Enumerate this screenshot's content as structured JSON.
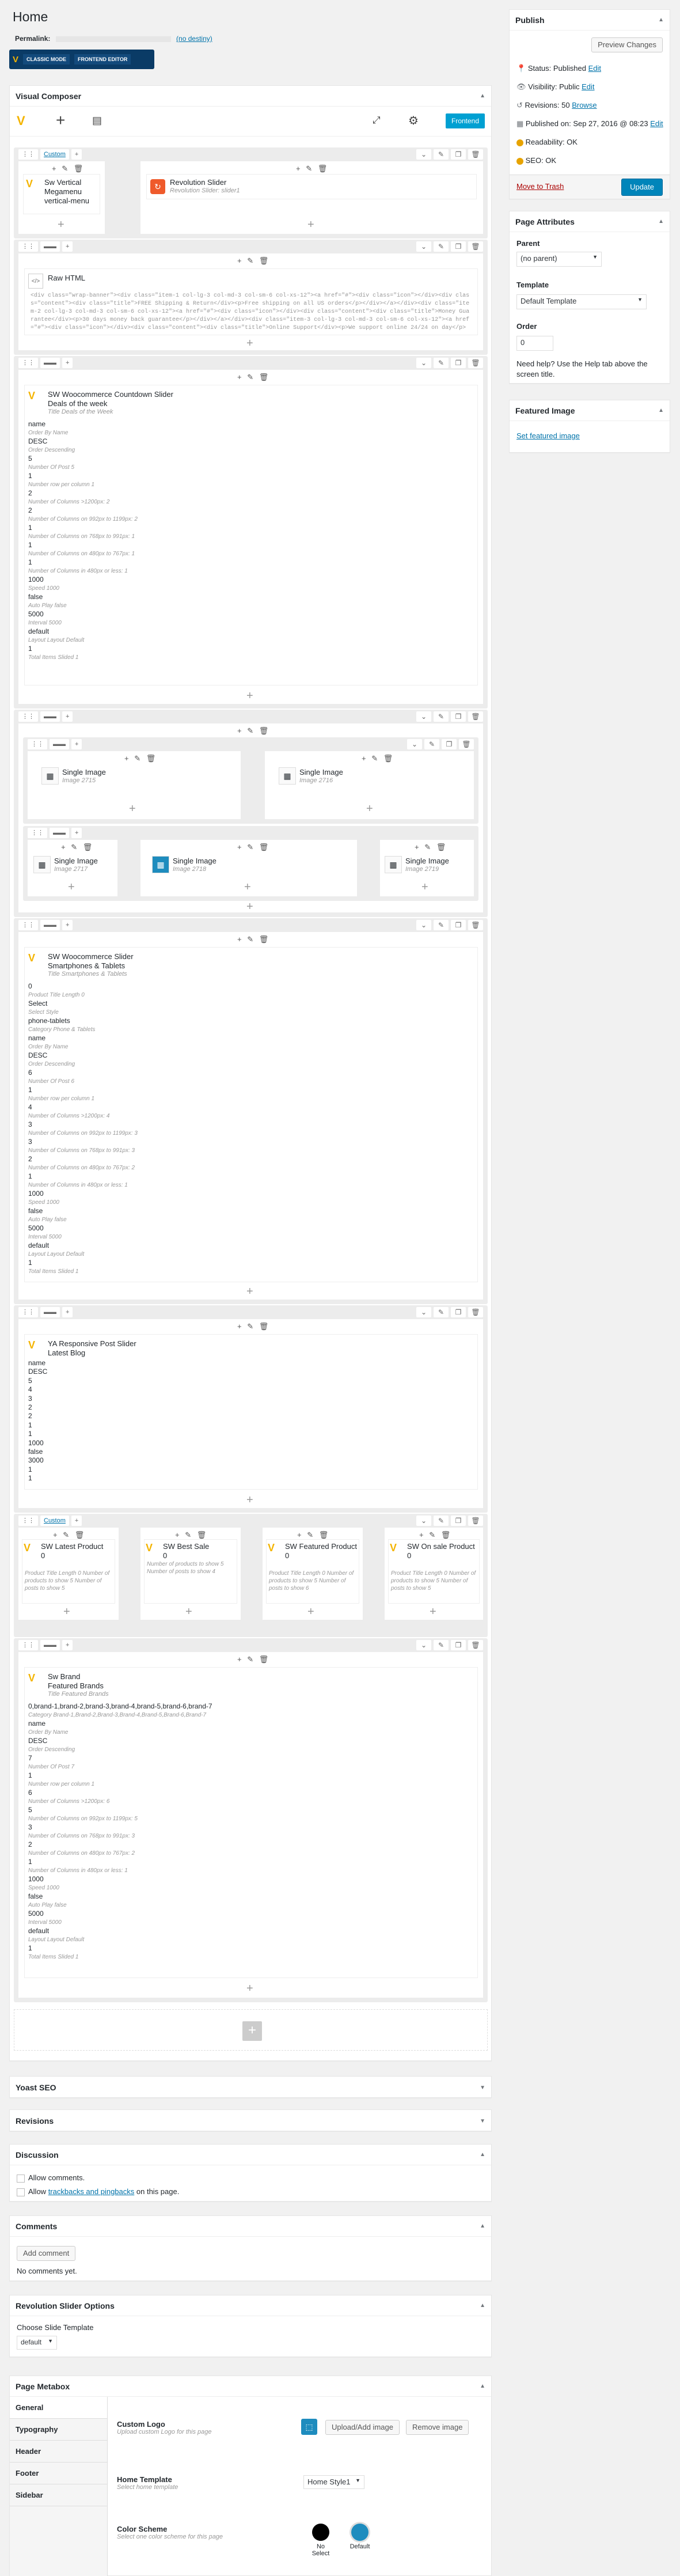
{
  "page": {
    "heading": "Home",
    "permalink_label": "Permalink:",
    "permalink_action": "(no destiny)",
    "classic_mode": "CLASSIC MODE",
    "frontend_editor": "FRONTEND EDITOR"
  },
  "vc": {
    "title": "Visual Composer",
    "frontend_btn": "Frontend",
    "custom_label": "Custom"
  },
  "rows": {
    "r1": {
      "el1_title": "Sw Vertical Megamenu",
      "el1_sub": "vertical-menu",
      "el2_title": "Revolution Slider",
      "el2_sub": "Revolution Slider: slider1"
    },
    "r2": {
      "title": "Raw HTML",
      "code": "<div class=\"wrap-banner\"><div class=\"item-1 col-lg-3 col-md-3 col-sm-6 col-xs-12\"><a href=\"#\"><div class=\"icon\"></div><div class=\"content\"><div class=\"title\">FREE Shipping & Return</div><p>Free shipping on all US orders</p></div></a></div><div class=\"item-2 col-lg-3 col-md-3 col-sm-6 col-xs-12\"><a href=\"#\"><div class=\"icon\"></div><div class=\"content\"><div class=\"title\">Money Guarantee</div><p>30 days money back guarantee</p></div></a></div><div class=\"item-3 col-lg-3 col-md-3 col-sm-6 col-xs-12\"><a href=\"#\"><div class=\"icon\"></div><div class=\"content\"><div class=\"title\">Online Support</div><p>We support online 24/24 on day</p></div></a></div></div>"
    },
    "r3": {
      "title": "SW Woocommerce Countdown Slider",
      "sub": "Deals of the week",
      "sub2": "Title Deals of the Week",
      "items": [
        [
          "name",
          "Order By Name"
        ],
        [
          "DESC",
          "Order Descending"
        ],
        [
          "5",
          "Number Of Post 5"
        ],
        [
          "1",
          "Number row per column 1"
        ],
        [
          "2",
          "Number of Columns >1200px: 2"
        ],
        [
          "2",
          "Number of Columns on 992px to 1199px: 2"
        ],
        [
          "1",
          "Number of Columns on 768px to 991px: 1"
        ],
        [
          "1",
          "Number of Columns on 480px to 767px: 1"
        ],
        [
          "1",
          "Number of Columns in 480px or less: 1"
        ],
        [
          "1000",
          "Speed 1000"
        ],
        [
          "false",
          "Auto Play false"
        ],
        [
          "5000",
          "Interval 5000"
        ],
        [
          "default",
          "Layout Layout Default"
        ],
        [
          "1",
          "Total Items Slided 1"
        ]
      ]
    },
    "r4": {
      "s1": "Single Image",
      "s1sub": "Image 2715",
      "s2": "Single Image",
      "s2sub": "Image 2716",
      "s3": "Single Image",
      "s3sub": "Image 2717",
      "s4": "Single Image",
      "s4sub": "Image 2718",
      "s5": "Single Image",
      "s5sub": "Image 2719"
    },
    "r5": {
      "title": "SW Woocommerce Slider",
      "sub": "Smartphones & Tablets",
      "sub2": "Title Smartphones & Tablets",
      "items": [
        [
          "0",
          "Product Title Length 0"
        ],
        [
          "Select",
          "Select Style"
        ],
        [
          "phone-tablets",
          "Category Phone & Tablets"
        ],
        [
          "name",
          "Order By Name"
        ],
        [
          "DESC",
          "Order Descending"
        ],
        [
          "6",
          "Number Of Post 6"
        ],
        [
          "1",
          "Number row per column 1"
        ],
        [
          "4",
          "Number of Columns >1200px: 4"
        ],
        [
          "3",
          "Number of Columns on 992px to 1199px: 3"
        ],
        [
          "3",
          "Number of Columns on 768px to 991px: 3"
        ],
        [
          "2",
          "Number of Columns on 480px to 767px: 2"
        ],
        [
          "1",
          "Number of Columns in 480px or less: 1"
        ],
        [
          "1000",
          "Speed 1000"
        ],
        [
          "false",
          "Auto Play false"
        ],
        [
          "5000",
          "Interval 5000"
        ],
        [
          "default",
          "Layout Layout Default"
        ],
        [
          "1",
          "Total Items Slided 1"
        ]
      ]
    },
    "r6": {
      "title": "YA Responsive Post Slider",
      "sub": "Latest Blog",
      "items": [
        "name",
        "DESC",
        "5",
        "4",
        "3",
        "2",
        "2",
        "1",
        "1",
        "1000",
        "false",
        "3000",
        "1",
        "1"
      ]
    },
    "r7": {
      "c1_title": "SW Latest Product",
      "c1_v": "0",
      "c1_desc": "Product Title Length 0 Number of products to show 5 Number of posts to show 5",
      "c2_title": "SW Best Sale",
      "c2_v": "0",
      "c2_desc": "Number of products to show 5 Number of posts to show 4",
      "c3_title": "SW Featured Product",
      "c3_v": "0",
      "c3_desc": "Product Title Length 0 Number of products to show 5 Number of posts to show 6",
      "c4_title": "SW On sale Product",
      "c4_v": "0",
      "c4_desc": "Product Title Length 0 Number of products to show 5 Number of posts to show 5"
    },
    "r8": {
      "title": "Sw Brand",
      "sub": "Featured Brands",
      "sub2": "Title Featured Brands",
      "brands": "0,brand-1,brand-2,brand-3,brand-4,brand-5,brand-6,brand-7",
      "brands_k": "Category Brand-1,Brand-2,Brand-3,Brand-4,Brand-5,Brand-6,Brand-7",
      "items": [
        [
          "name",
          "Order By Name"
        ],
        [
          "DESC",
          "Order Descending"
        ],
        [
          "7",
          "Number Of Post 7"
        ],
        [
          "1",
          "Number row per column 1"
        ],
        [
          "6",
          "Number of Columns >1200px: 6"
        ],
        [
          "5",
          "Number of Columns on 992px to 1199px: 5"
        ],
        [
          "3",
          "Number of Columns on 768px to 991px: 3"
        ],
        [
          "2",
          "Number of Columns on 480px to 767px: 2"
        ],
        [
          "1",
          "Number of Columns in 480px or less: 1"
        ],
        [
          "1000",
          "Speed 1000"
        ],
        [
          "false",
          "Auto Play false"
        ],
        [
          "5000",
          "Interval 5000"
        ],
        [
          "default",
          "Layout Layout Default"
        ],
        [
          "1",
          "Total Items Slided 1"
        ]
      ]
    }
  },
  "boxes": {
    "yoast": "Yoast SEO",
    "revisions": "Revisions",
    "discussion": "Discussion",
    "allow_comments": "Allow comments.",
    "allow_tb_pre": "Allow ",
    "allow_tb_link": "trackbacks and pingbacks",
    "allow_tb_post": " on this page.",
    "comments": "Comments",
    "add_comment": "Add comment",
    "no_comments": "No comments yet.",
    "revslider": "Revolution Slider Options",
    "choose_slide": "Choose Slide Template",
    "slide_default": "default"
  },
  "metabox": {
    "title": "Page Metabox",
    "tabs": [
      "General",
      "Typography",
      "Header",
      "Footer",
      "Sidebar"
    ],
    "logo_label": "Custom Logo",
    "logo_desc": "Upload custom Logo for this page",
    "upload_btn": "Upload/Add image",
    "remove_btn": "Remove image",
    "home_tpl_label": "Home Template",
    "home_tpl_desc": "Select home template",
    "home_tpl_value": "Home Style1",
    "scheme_label": "Color Scheme",
    "scheme_desc": "Select one color scheme for this page",
    "scheme_opt1": "No Select",
    "scheme_opt2": "Default"
  },
  "publish": {
    "title": "Publish",
    "preview": "Preview Changes",
    "status": "Status: Published",
    "status_edit": "Edit",
    "visibility": "Visibility: Public",
    "vis_edit": "Edit",
    "revisions": "Revisions: 50",
    "rev_browse": "Browse",
    "published": "Published on: Sep 27, 2016 @ 08:23",
    "pub_edit": "Edit",
    "readability": "Readability: OK",
    "seo": "SEO: OK",
    "trash": "Move to Trash",
    "update": "Update"
  },
  "attrs": {
    "title": "Page Attributes",
    "parent_label": "Parent",
    "parent_value": "(no parent)",
    "template_label": "Template",
    "template_value": "Default Template",
    "order_label": "Order",
    "order_value": "0",
    "help": "Need help? Use the Help tab above the screen title."
  },
  "featured": {
    "title": "Featured Image",
    "link": "Set featured image"
  },
  "colors": {
    "accent": "#0085ba",
    "link": "#0073aa",
    "scheme_black": "#000000",
    "scheme_blue": "#1e8cbe"
  }
}
